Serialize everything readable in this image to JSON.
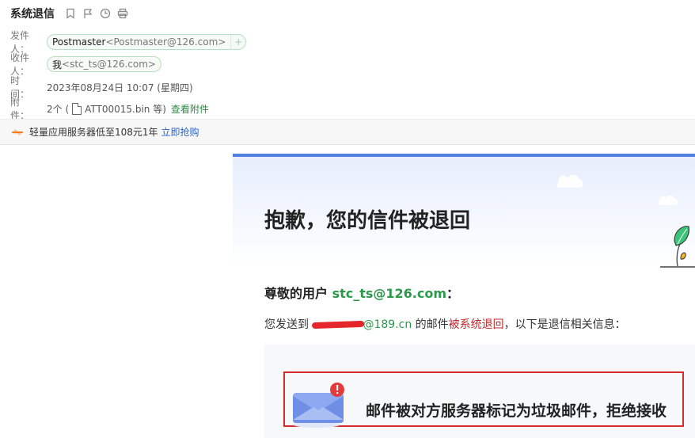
{
  "subject": "系统退信",
  "toolbar": {
    "icons": [
      "bookmark-icon",
      "flag-icon",
      "clock-icon",
      "print-icon"
    ]
  },
  "sender": {
    "label": "发件人：",
    "name": "Postmaster",
    "address": "<Postmaster@126.com>",
    "add_symbol": "+"
  },
  "recipient": {
    "label": "收件人：",
    "name": "我",
    "address": "<stc_ts@126.com>"
  },
  "time": {
    "label": "时　间：",
    "value": "2023年08月24日 10:07 (星期四)"
  },
  "attachment": {
    "label": "附　件：",
    "count_prefix": "2个 (",
    "file_name": "ATT00015.bin 等)",
    "view_link": "查看附件"
  },
  "ad": {
    "text": "轻量应用服务器低至108元1年",
    "link": "立即抢购"
  },
  "bounce": {
    "title": "抱歉，您的信件被退回",
    "greeting_prefix": "尊敬的用户 ",
    "user_email": "stc_ts@126.com",
    "greeting_suffix": "：",
    "desc_prefix": "您发送到 ",
    "target_email_visible": "@189.cn",
    "desc_middle": " 的邮件",
    "desc_red": "被系统退回",
    "desc_suffix": "，以下是退信相关信息：",
    "notice": "邮件被对方服务器标记为垃圾邮件，拒绝接收"
  },
  "colors": {
    "accent_green": "#2a9a4a",
    "alert_red": "#d92b2b",
    "brand_blue": "#4f7fe0"
  }
}
